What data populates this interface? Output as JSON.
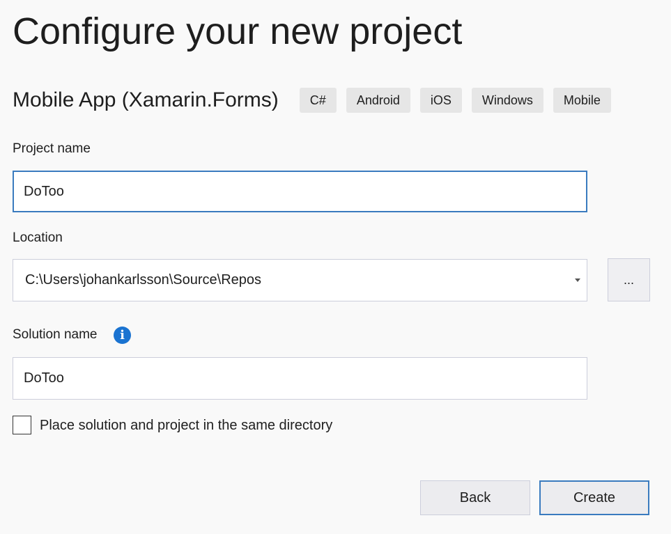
{
  "page": {
    "title": "Configure your new project"
  },
  "template": {
    "name": "Mobile App (Xamarin.Forms)",
    "tags": [
      "C#",
      "Android",
      "iOS",
      "Windows",
      "Mobile"
    ]
  },
  "project_name": {
    "label": "Project name",
    "value": "DoToo"
  },
  "location": {
    "label": "Location",
    "value": "C:\\Users\\johankarlsson\\Source\\Repos",
    "browse_label": "..."
  },
  "solution_name": {
    "label": "Solution name",
    "value": "DoToo",
    "info_glyph": "i"
  },
  "same_directory": {
    "label": "Place solution and project in the same directory",
    "checked": false
  },
  "buttons": {
    "back": "Back",
    "create": "Create"
  },
  "colors": {
    "accent": "#3a7bbf",
    "info": "#1a73d1",
    "tag_background": "#e6e6e6",
    "background": "#f9f9f9"
  }
}
